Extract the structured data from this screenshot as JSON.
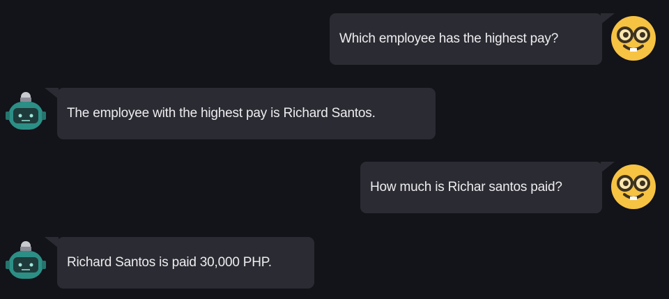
{
  "messages": [
    {
      "role": "user",
      "avatar": "nerd-face-icon",
      "text": "Which employee has the highest pay?"
    },
    {
      "role": "bot",
      "avatar": "robot-icon",
      "text": "The employee with the highest pay is Richard Santos."
    },
    {
      "role": "user",
      "avatar": "nerd-face-icon",
      "text": "How much is Richar santos paid?"
    },
    {
      "role": "bot",
      "avatar": "robot-icon",
      "text": "Richard Santos is paid 30,000 PHP."
    }
  ],
  "colors": {
    "background": "#13131a",
    "bubble": "#2b2b33",
    "text": "#ededf0",
    "user_avatar": "#f6c343",
    "bot_avatar": "#2c8f86"
  }
}
